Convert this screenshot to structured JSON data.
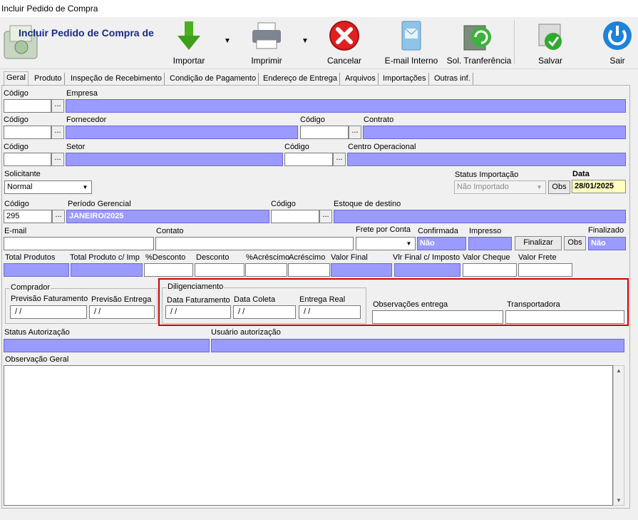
{
  "window": {
    "title": "Incluir Pedido de Compra"
  },
  "header": {
    "heading": "Incluir Pedido de Compra de"
  },
  "toolbar": {
    "importar": "Importar",
    "imprimir": "Imprimir",
    "cancelar": "Cancelar",
    "email": "E-mail Interno",
    "sol_transferencia": "Sol. Tranferência",
    "salvar": "Salvar",
    "sair": "Sair"
  },
  "tabs": [
    "Geral",
    "Produto",
    "Inspeção de Recebimento",
    "Condição de Pagamento",
    "Endereço de Entrega",
    "Arquivos",
    "Importações",
    "Outras inf."
  ],
  "labels": {
    "codigo": "Código",
    "empresa": "Empresa",
    "fornecedor": "Fornecedor",
    "contrato": "Contrato",
    "setor": "Setor",
    "centro_operacional": "Centro Operacional",
    "solicitante": "Solicitante",
    "status_importacao": "Status Importação",
    "data": "Data",
    "periodo_gerencial": "Período Gerencial",
    "estoque_destino": "Estoque de destino",
    "email": "E-mail",
    "contato": "Contato",
    "frete_por_conta": "Frete por Conta",
    "confirmada": "Confirmada",
    "impresso": "Impresso",
    "finalizado": "Finalizado",
    "total_produtos": "Total Produtos",
    "total_produto_imp": "Total Produto c/ Imp",
    "pct_desconto": "%Desconto",
    "desconto": "Desconto",
    "pct_acrescimo": "%Acréscimo",
    "acrescimo": "Acréscimo",
    "valor_final": "Valor Final",
    "vlr_final_imposto": "Vlr Final c/ Imposto",
    "valor_cheque": "Valor Cheque",
    "valor_frete": "Valor Frete",
    "comprador": "Comprador",
    "previsao_faturamento": "Previsão Faturamento",
    "previsao_entrega": "Previsão Entrega",
    "diligenciamento": "Diligenciamento",
    "data_faturamento": "Data Faturamento",
    "data_coleta": "Data Coleta",
    "entrega_real": "Entrega Real",
    "observacoes_entrega": "Observações entrega",
    "transportadora": "Transportadora",
    "status_autorizacao": "Status Autorização",
    "usuario_autorizacao": "Usuário autorização",
    "observacao_geral": "Observação Geral"
  },
  "values": {
    "solicitante": "Normal",
    "status_importacao": "Não Importado",
    "data": "28/01/2025",
    "periodo_codigo": "295",
    "periodo_gerencial": "JANEIRO/2025",
    "confirmada": "Não",
    "finalizado": "Não",
    "date_empty": " / /"
  },
  "buttons": {
    "dots": "...",
    "obs": "Obs",
    "finalizar": "Finalizar"
  },
  "colors": {
    "field_blue": "#9a9aff",
    "highlight_red": "#d00000",
    "date_yellow": "#ffffc0"
  }
}
